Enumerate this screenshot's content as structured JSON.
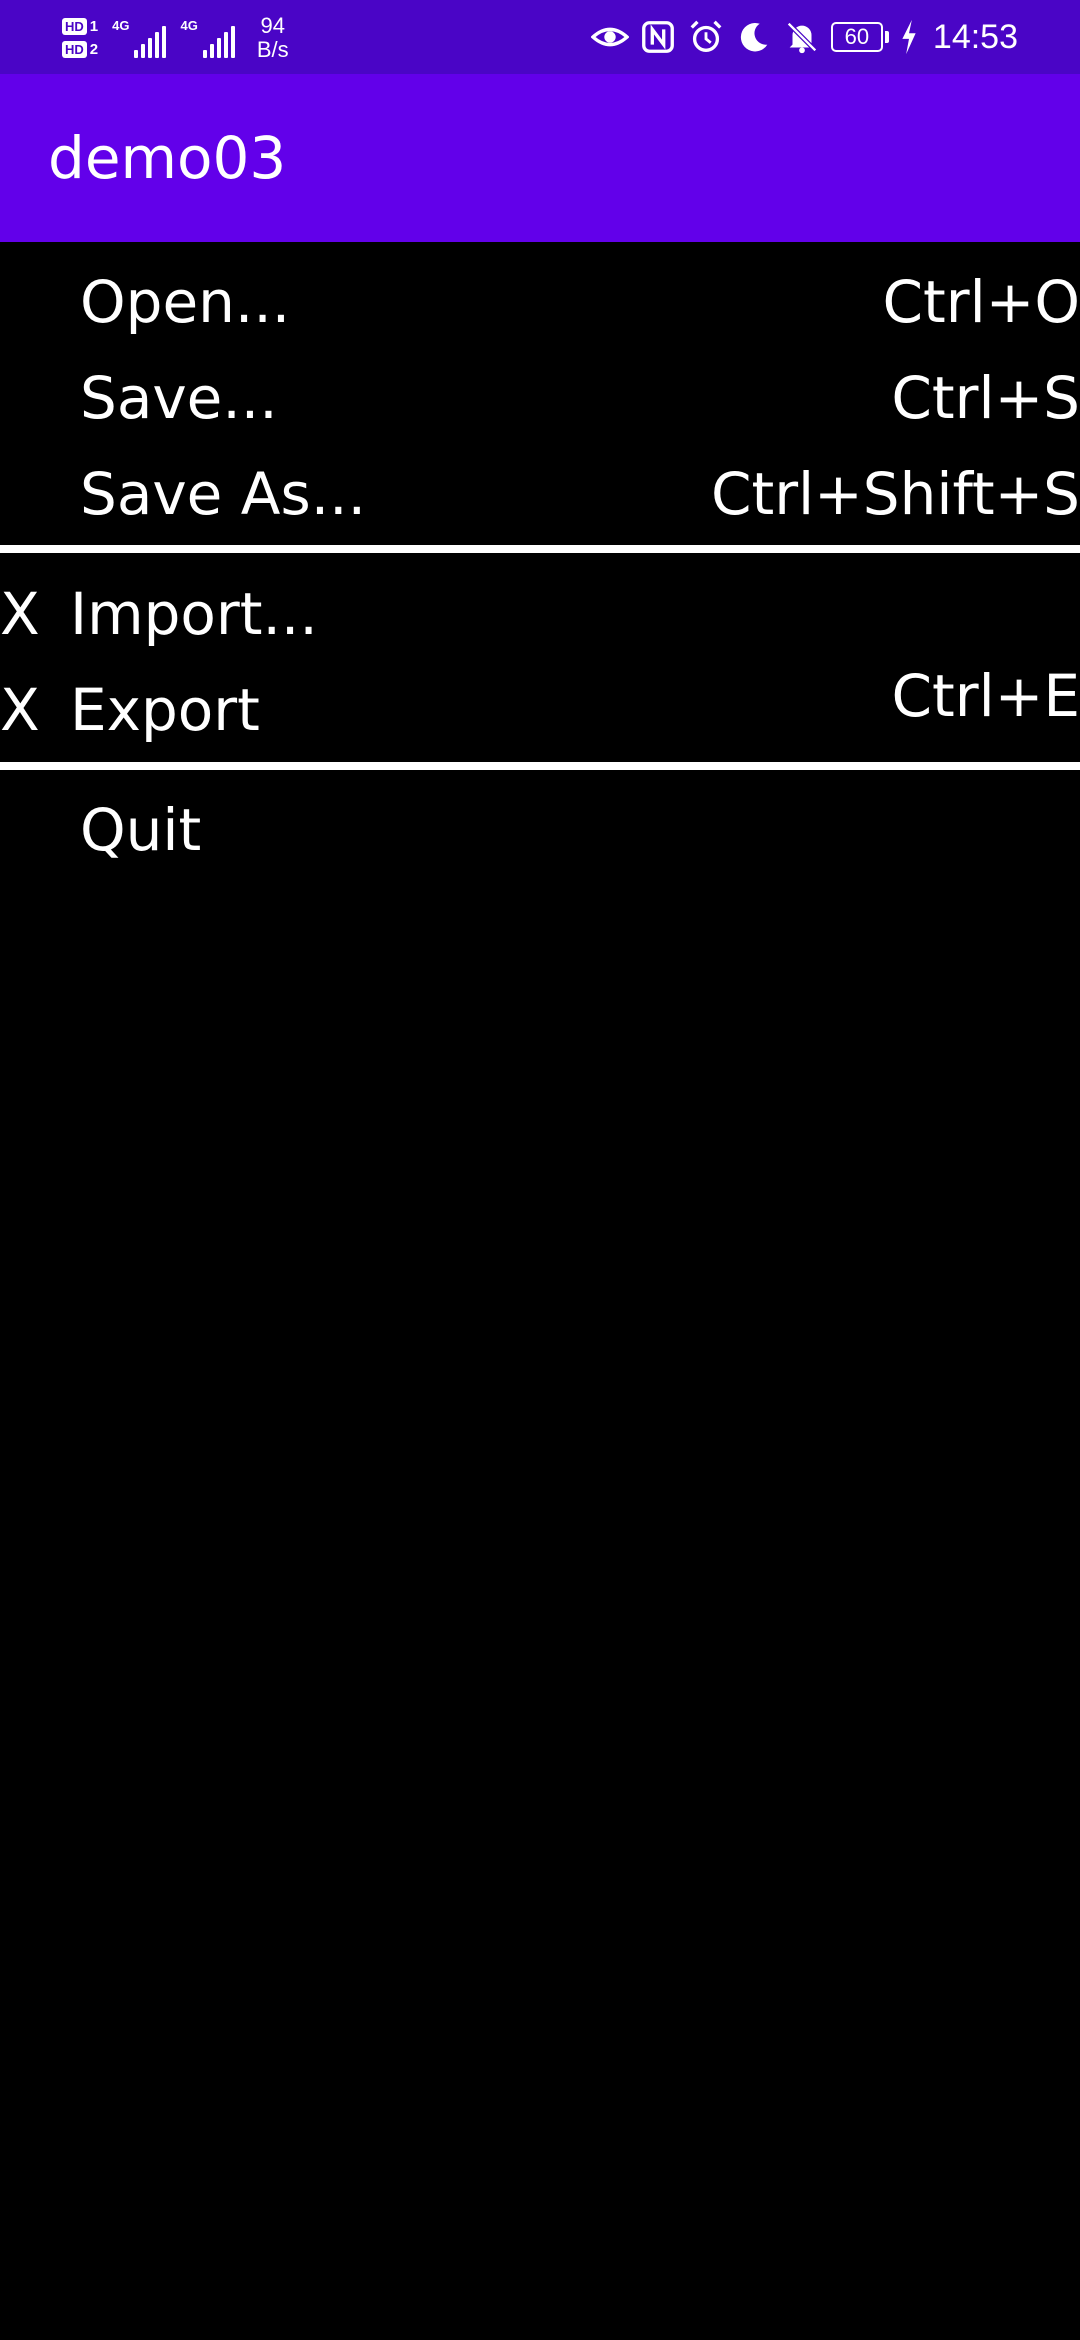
{
  "status_bar": {
    "hd1": "HD",
    "hd1_num": "1",
    "hd2": "HD",
    "hd2_num": "2",
    "signal1_label": "4G",
    "signal2_label": "4G",
    "net_speed_value": "94",
    "net_speed_unit": "B/s",
    "battery_level": "60",
    "time": "14:53",
    "icons": [
      "eye-icon",
      "nfc-icon",
      "alarm-icon",
      "moon-icon",
      "bell-off-icon",
      "battery-icon",
      "charging-icon"
    ]
  },
  "app_bar": {
    "title": "demo03",
    "color": "#6200ea"
  },
  "status_bar_color": "#4a05c6",
  "menu": {
    "group1": [
      {
        "label": "Open...",
        "shortcut": "Ctrl+O"
      },
      {
        "label": "Save...",
        "shortcut": "Ctrl+S"
      },
      {
        "label": "Save As...",
        "shortcut": "Ctrl+Shift+S"
      }
    ],
    "group2": [
      {
        "check": "X",
        "label": "Import...",
        "shortcut": ""
      },
      {
        "check": "X",
        "label": "Export",
        "shortcut": "Ctrl+E"
      }
    ],
    "group3": [
      {
        "label": "Quit",
        "shortcut": ""
      }
    ]
  }
}
